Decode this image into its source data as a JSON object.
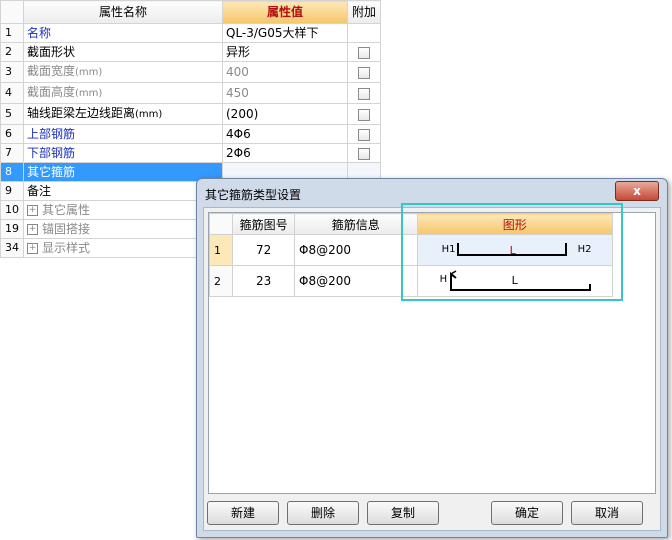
{
  "grid": {
    "header": {
      "name": "属性名称",
      "value": "属性值",
      "extra": "附加"
    },
    "rows": [
      {
        "num": "1",
        "name": "名称",
        "value": "QL-3/G05大样下",
        "unit": ""
      },
      {
        "num": "2",
        "name": "截面形状",
        "value": "异形",
        "unit": ""
      },
      {
        "num": "3",
        "name": "截面宽度",
        "unit": "(mm)",
        "value": "400"
      },
      {
        "num": "4",
        "name": "截面高度",
        "unit": "(mm)",
        "value": "450"
      },
      {
        "num": "5",
        "name": "轴线距梁左边线距离",
        "unit": "(mm)",
        "value": "(200)"
      },
      {
        "num": "6",
        "name": "上部钢筋",
        "value": "4Φ6",
        "unit": ""
      },
      {
        "num": "7",
        "name": "下部钢筋",
        "value": "2Φ6",
        "unit": ""
      },
      {
        "num": "8",
        "name": "其它箍筋",
        "value": "",
        "unit": ""
      },
      {
        "num": "9",
        "name": "备注",
        "value": "",
        "unit": ""
      },
      {
        "num": "10",
        "name": "其它属性",
        "value": "",
        "unit": ""
      },
      {
        "num": "19",
        "name": "锚固搭接",
        "value": "",
        "unit": ""
      },
      {
        "num": "34",
        "name": "显示样式",
        "value": "",
        "unit": ""
      }
    ]
  },
  "dialog": {
    "title": "其它箍筋类型设置",
    "close_label": "x",
    "columns": {
      "code": "箍筋图号",
      "info": "箍筋信息",
      "shape": "图形"
    },
    "rows": [
      {
        "num": "1",
        "code": "72",
        "info": "Φ8@200",
        "labels": {
          "left": "H1",
          "mid": "L",
          "right": "H2"
        }
      },
      {
        "num": "2",
        "code": "23",
        "info": "Φ8@200",
        "labels": {
          "left": "H",
          "mid": "L"
        }
      }
    ],
    "buttons": {
      "new": "新建",
      "delete": "删除",
      "copy": "复制",
      "ok": "确定",
      "cancel": "取消"
    }
  },
  "colors": {
    "accent_cyan": "#35c7c7",
    "selection_blue": "#3399ff",
    "shape_text_red": "#d40000"
  }
}
